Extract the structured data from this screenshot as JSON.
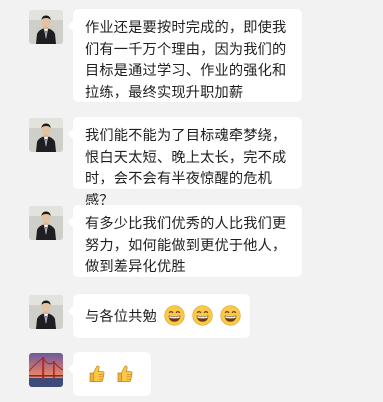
{
  "messages": [
    {
      "sender": "man-avatar",
      "text": "作业还是要按时完成的，即使我们有一千万个理由，因为我们的目标是通过学习、作业的强化和拉练，最终实现升职加薪"
    },
    {
      "sender": "man-avatar",
      "text": "我们能不能为了目标魂牵梦绕，恨白天太短、晚上太长，完不成时，会不会有半夜惊醒的危机感？"
    },
    {
      "sender": "man-avatar",
      "text": "有多少比我们优秀的人比我们更努力，如何能做到更优于他人，做到差异化优胜"
    },
    {
      "sender": "man-avatar",
      "text": "与各位共勉",
      "emojis": [
        "grinning-emoji",
        "grinning-emoji",
        "grinning-emoji"
      ]
    },
    {
      "sender": "bridge-avatar",
      "text": "",
      "emojis": [
        "thumbs-up-emoji",
        "thumbs-up-emoji"
      ]
    }
  ],
  "colors": {
    "background": "#f2f2f2",
    "bubble": "#ffffff",
    "text": "#1f1f1f"
  }
}
